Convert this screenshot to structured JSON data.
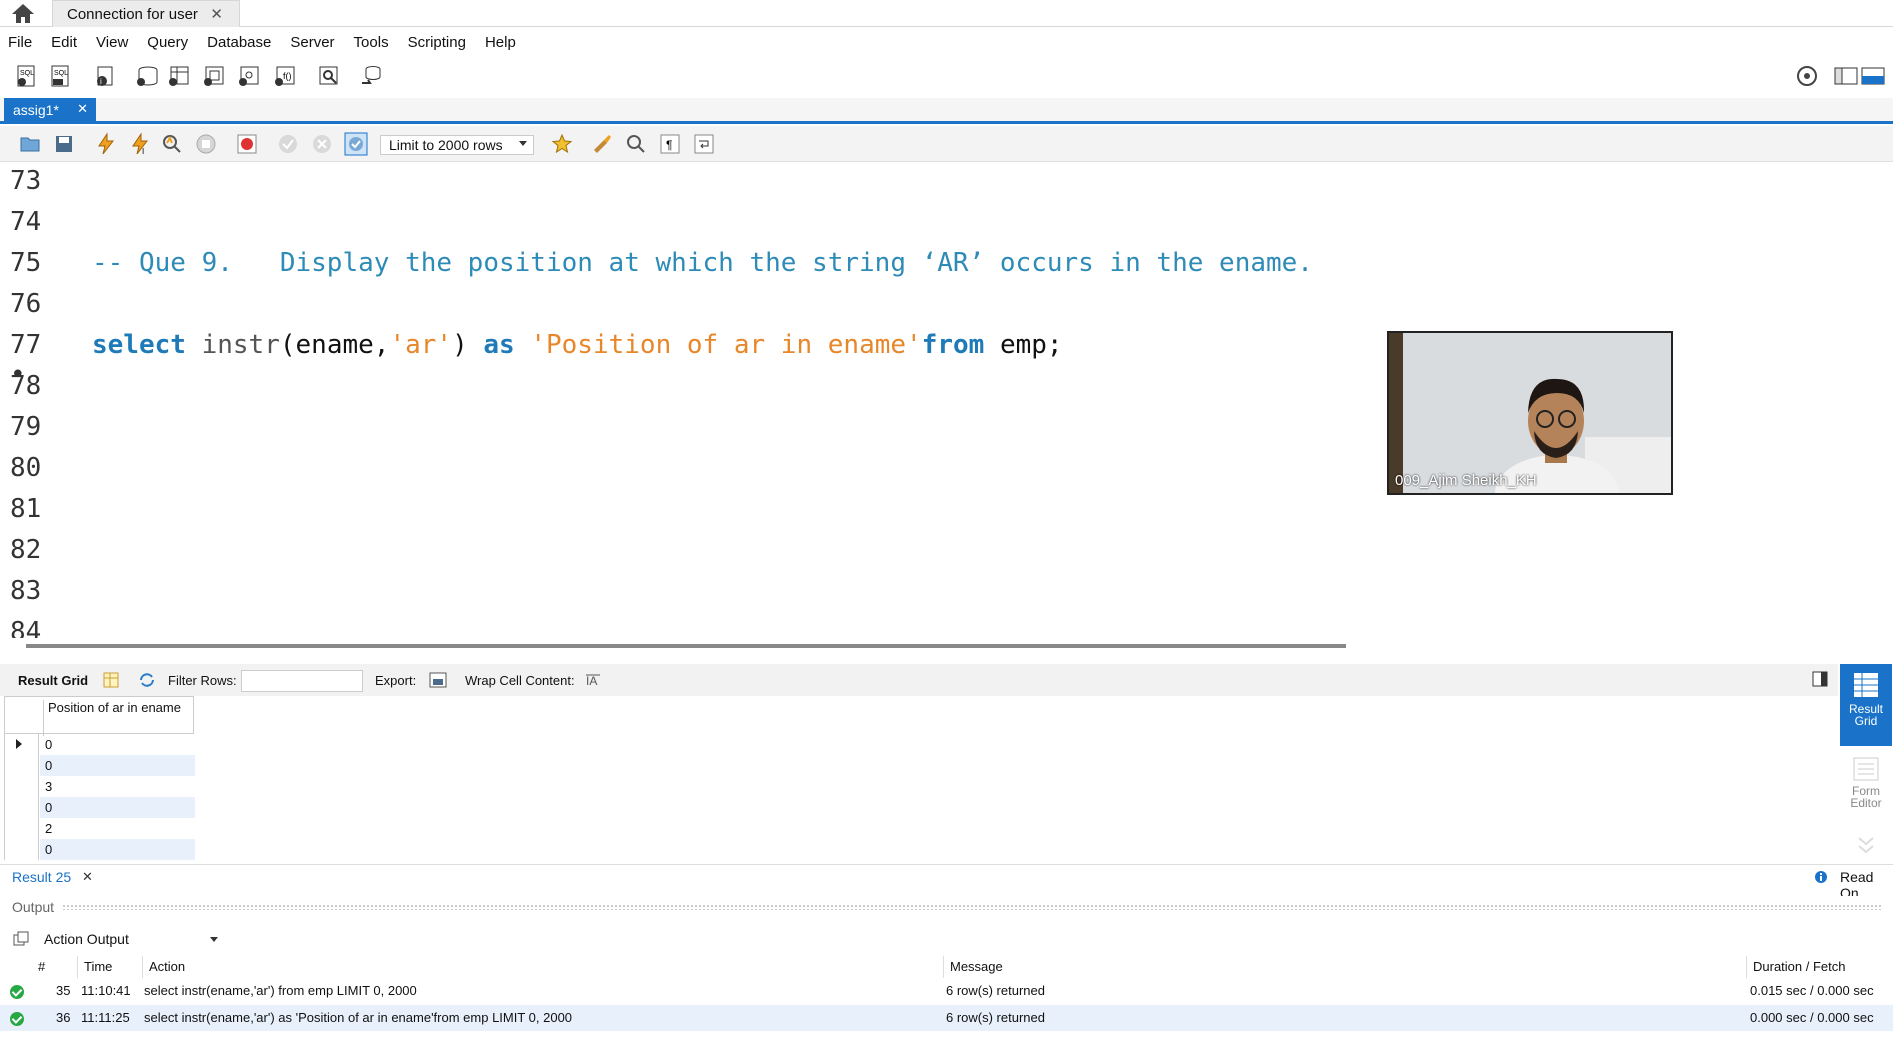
{
  "window": {
    "tab_title": "Connection for user"
  },
  "menu": [
    "File",
    "Edit",
    "View",
    "Query",
    "Database",
    "Server",
    "Tools",
    "Scripting",
    "Help"
  ],
  "sql_tab": {
    "label": "assig1*"
  },
  "editor_toolbar": {
    "limit_label": "Limit to 2000 rows"
  },
  "editor": {
    "lines": [
      {
        "num": "73",
        "text": ""
      },
      {
        "num": "74",
        "text": ""
      },
      {
        "num": "75",
        "text": "-- Que 9.   Display the position at which the string ‘AR’ occurs in the ename."
      },
      {
        "num": "76",
        "text": ""
      },
      {
        "num": "77 •",
        "text": ""
      },
      {
        "num": "78",
        "text": ""
      },
      {
        "num": "79",
        "text": ""
      },
      {
        "num": "80",
        "text": ""
      },
      {
        "num": "81",
        "text": ""
      },
      {
        "num": "82",
        "text": ""
      },
      {
        "num": "83",
        "text": ""
      },
      {
        "num": "84",
        "text": ""
      }
    ],
    "stmt": {
      "kw1": "select",
      "fn": "instr",
      "paren_open": "(",
      "arg": "ename,",
      "strarg": "'ar'",
      "paren_close": ")",
      "kw2": "as",
      "alias": "'Position of ar in ename'",
      "kw3": "from",
      "tbl": "emp;"
    }
  },
  "video": {
    "participant": "009_Ajim Sheikh_KH"
  },
  "result_toolbar": {
    "grid_label": "Result Grid",
    "filter_label": "Filter Rows:",
    "export_label": "Export:",
    "wrap_label": "Wrap Cell Content:"
  },
  "grid": {
    "header": "Position of ar in ename",
    "rows": [
      "0",
      "0",
      "3",
      "0",
      "2",
      "0"
    ]
  },
  "side_panel": {
    "result_grid": "Result Grid",
    "form_editor": "Form Editor"
  },
  "result_tab": {
    "label": "Result 25",
    "status": "Read On"
  },
  "output": {
    "title": "Output",
    "selector": "Action Output",
    "columns": [
      "#",
      "Time",
      "Action",
      "Message",
      "Duration / Fetch"
    ],
    "rows": [
      {
        "num": "35",
        "time": "11:10:41",
        "action": "select instr(ename,'ar') from emp LIMIT 0, 2000",
        "message": "6 row(s) returned",
        "duration": "0.015 sec / 0.000 sec"
      },
      {
        "num": "36",
        "time": "11:11:25",
        "action": "select instr(ename,'ar') as 'Position of ar in ename'from emp LIMIT 0, 2000",
        "message": "6 row(s) returned",
        "duration": "0.000 sec / 0.000 sec"
      }
    ]
  },
  "colors": {
    "accent": "#1a73c8",
    "keyword": "#1f7ab8",
    "string": "#e8872a",
    "comment": "#2e8bb8",
    "ok": "#27a844"
  }
}
